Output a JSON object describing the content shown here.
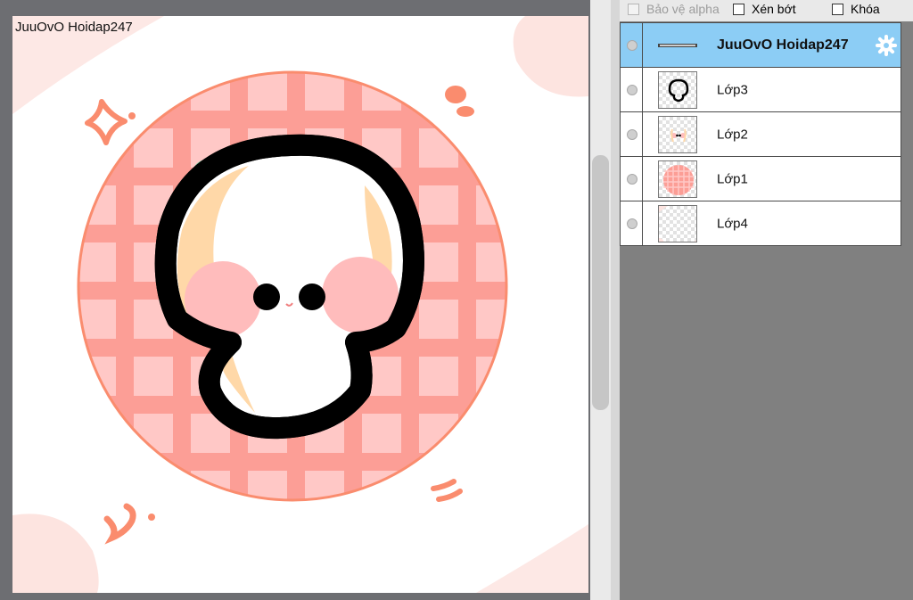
{
  "canvas": {
    "label": "JuuOvO Hoidap247"
  },
  "layer_options": {
    "alpha_protect": "Bảo vệ alpha",
    "clip": "Xén bớt",
    "lock": "Khóa"
  },
  "layers": [
    {
      "label": "JuuOvO Hoidap247",
      "selected": true
    },
    {
      "label": "Lớp3",
      "selected": false
    },
    {
      "label": "Lớp2",
      "selected": false
    },
    {
      "label": "Lớp1",
      "selected": false
    },
    {
      "label": "Lớp4",
      "selected": false
    }
  ],
  "colors": {
    "selected_layer": "#8ccdf5",
    "plaid_base": "#fc9e96",
    "plaid_light": "#ffc8c6",
    "accent_orange": "#fa8c6e",
    "cheek_pink": "#ffbcbc"
  }
}
